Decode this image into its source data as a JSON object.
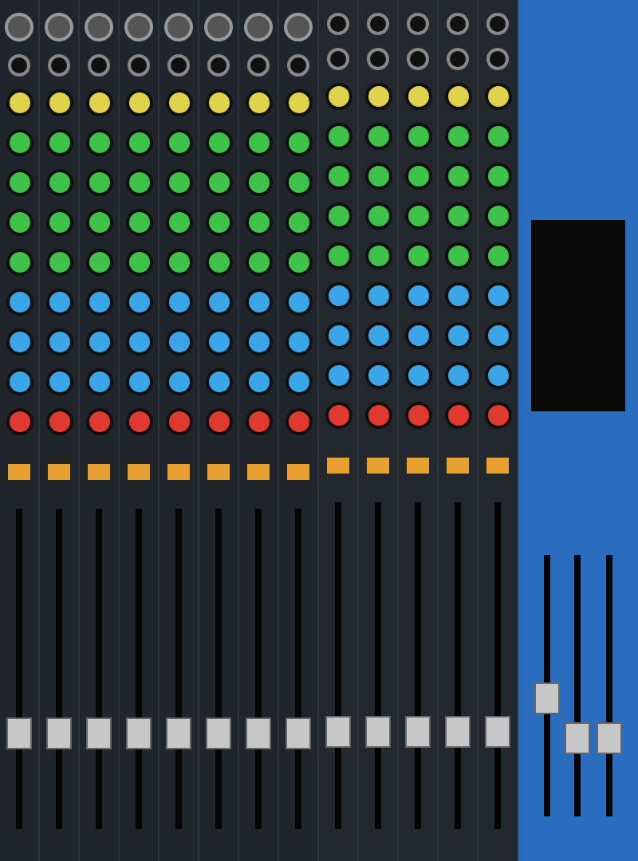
{
  "knob_rows": [
    {
      "color": "#e0d24a"
    },
    {
      "color": "#3fc24a"
    },
    {
      "color": "#3fc24a"
    },
    {
      "color": "#3fc24a"
    },
    {
      "color": "#3fc24a"
    },
    {
      "color": "#3aa6e8"
    },
    {
      "color": "#3aa6e8"
    },
    {
      "color": "#3aa6e8"
    },
    {
      "color": "#e03a30"
    }
  ],
  "channel_strips": [
    {
      "kind": "mono",
      "level": 0.3,
      "on": true
    },
    {
      "kind": "mono",
      "level": 0.3,
      "on": true
    },
    {
      "kind": "mono",
      "level": 0.3,
      "on": true
    },
    {
      "kind": "mono",
      "level": 0.3,
      "on": true
    },
    {
      "kind": "mono",
      "level": 0.3,
      "on": true
    },
    {
      "kind": "mono",
      "level": 0.3,
      "on": true
    },
    {
      "kind": "mono",
      "level": 0.3,
      "on": true
    },
    {
      "kind": "mono",
      "level": 0.3,
      "on": true
    },
    {
      "kind": "stereo",
      "level": 0.3,
      "on": true
    },
    {
      "kind": "stereo",
      "level": 0.3,
      "on": true
    },
    {
      "kind": "stereo",
      "level": 0.3,
      "on": true
    },
    {
      "kind": "stereo",
      "level": 0.3,
      "on": true
    },
    {
      "kind": "stereo",
      "level": 0.3,
      "on": true
    }
  ],
  "master_faders": [
    {
      "level": 0.45
    },
    {
      "level": 0.3
    },
    {
      "level": 0.3
    }
  ]
}
